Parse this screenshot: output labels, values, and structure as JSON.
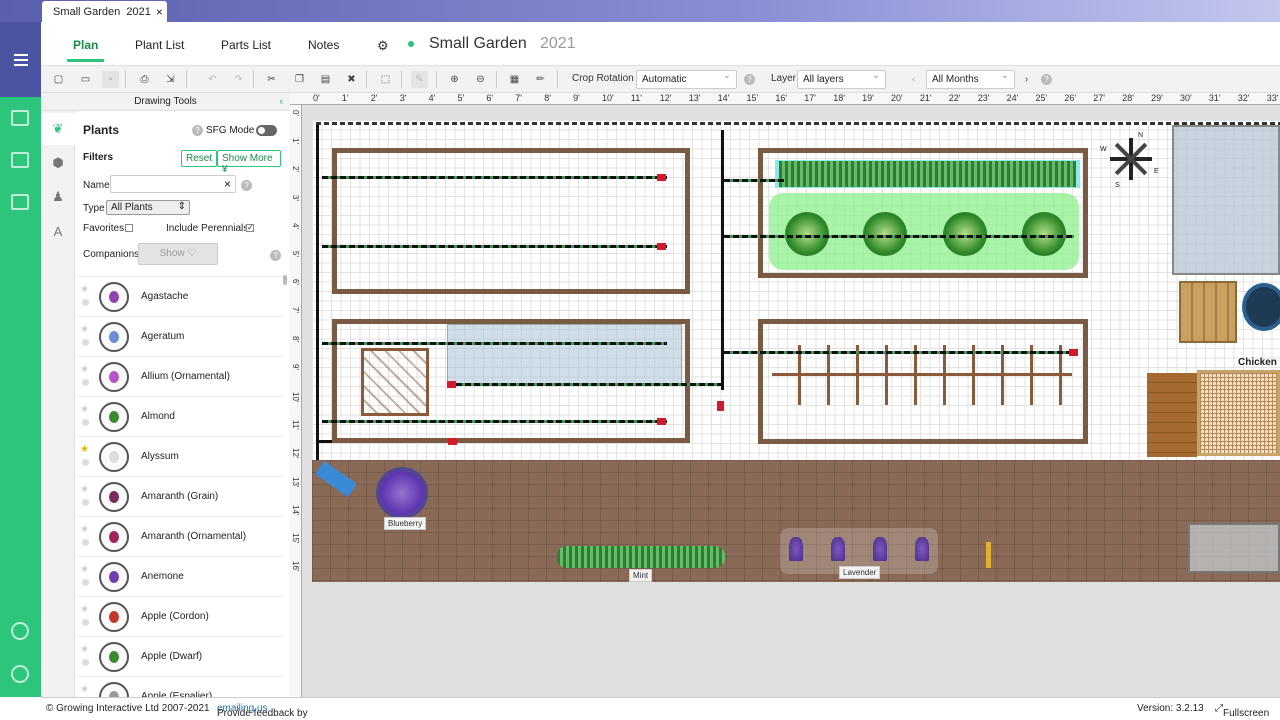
{
  "browser": {
    "tab_title": "Small Garden  2021",
    "close": "×"
  },
  "nav": {
    "tabs": [
      {
        "label": "Plan",
        "active": true
      },
      {
        "label": "Plant List"
      },
      {
        "label": "Parts List"
      },
      {
        "label": "Notes"
      }
    ],
    "project_title": "Small Garden",
    "project_year": "2021"
  },
  "toolbar": {
    "crop_rotation_label": "Crop Rotation",
    "crop_rotation_value": "Automatic",
    "layer_label": "Layer",
    "layer_value": "All layers",
    "months_value": "All Months"
  },
  "drawing_tools": {
    "title": "Drawing Tools"
  },
  "plants_panel": {
    "title": "Plants",
    "sfg_mode": "SFG Mode",
    "filters_label": "Filters",
    "reset": "Reset",
    "show_more": "Show More",
    "name_label": "Name",
    "name_value": "",
    "clear": "×",
    "type_label": "Type",
    "type_value": "All Plants",
    "favorites_label": "Favorites",
    "perennials_label": "Include Perennials",
    "perennials_checked": "✓",
    "companions_label": "Companions",
    "companions_button": "Show ♡",
    "items": [
      {
        "name": "Agastache",
        "favorite": false,
        "color": "#8e44ad"
      },
      {
        "name": "Ageratum",
        "favorite": false,
        "color": "#6a8fd4"
      },
      {
        "name": "Allium (Ornamental)",
        "favorite": false,
        "color": "#b455c9"
      },
      {
        "name": "Almond",
        "favorite": false,
        "color": "#3a8a2e"
      },
      {
        "name": "Alyssum",
        "favorite": true,
        "color": "#dddddd"
      },
      {
        "name": "Amaranth (Grain)",
        "favorite": false,
        "color": "#7b2d5b"
      },
      {
        "name": "Amaranth (Ornamental)",
        "favorite": false,
        "color": "#a0245a"
      },
      {
        "name": "Anemone",
        "favorite": false,
        "color": "#6e3fb0"
      },
      {
        "name": "Apple (Cordon)",
        "favorite": false,
        "color": "#c0392b"
      },
      {
        "name": "Apple (Dwarf)",
        "favorite": false,
        "color": "#3a8a2e"
      },
      {
        "name": "Apple (Espalier)",
        "favorite": false,
        "color": "#999999"
      }
    ]
  },
  "ruler": {
    "top": [
      "0'",
      "1'",
      "2'",
      "3'",
      "4'",
      "5'",
      "6'",
      "7'",
      "8'",
      "9'",
      "10'",
      "11'",
      "12'",
      "13'",
      "14'",
      "15'",
      "16'",
      "17'",
      "18'",
      "19'",
      "20'",
      "21'",
      "22'",
      "23'",
      "24'",
      "25'",
      "26'",
      "27'",
      "28'",
      "29'",
      "30'",
      "31'",
      "32'",
      "33'"
    ],
    "left": [
      "0'",
      "1'",
      "2'",
      "3'",
      "4'",
      "5'",
      "6'",
      "7'",
      "8'",
      "9'",
      "10'",
      "11'",
      "12'",
      "13'",
      "14'",
      "15'",
      "16'"
    ]
  },
  "canvas": {
    "labels": {
      "blueberry": "Blueberry",
      "mint": "Mint",
      "lavender": "Lavender",
      "chicken": "Chicken"
    },
    "compass": [
      "N",
      "E",
      "S",
      "W"
    ]
  },
  "footer": {
    "copyright": "© Growing Interactive Ltd 2007-2021",
    "feedback_prefix": "Provide feedback by ",
    "feedback_link": "emailing us",
    "feedback_suffix": ".",
    "version": "Version: 3.2.13",
    "fullscreen": "Fullscreen"
  }
}
